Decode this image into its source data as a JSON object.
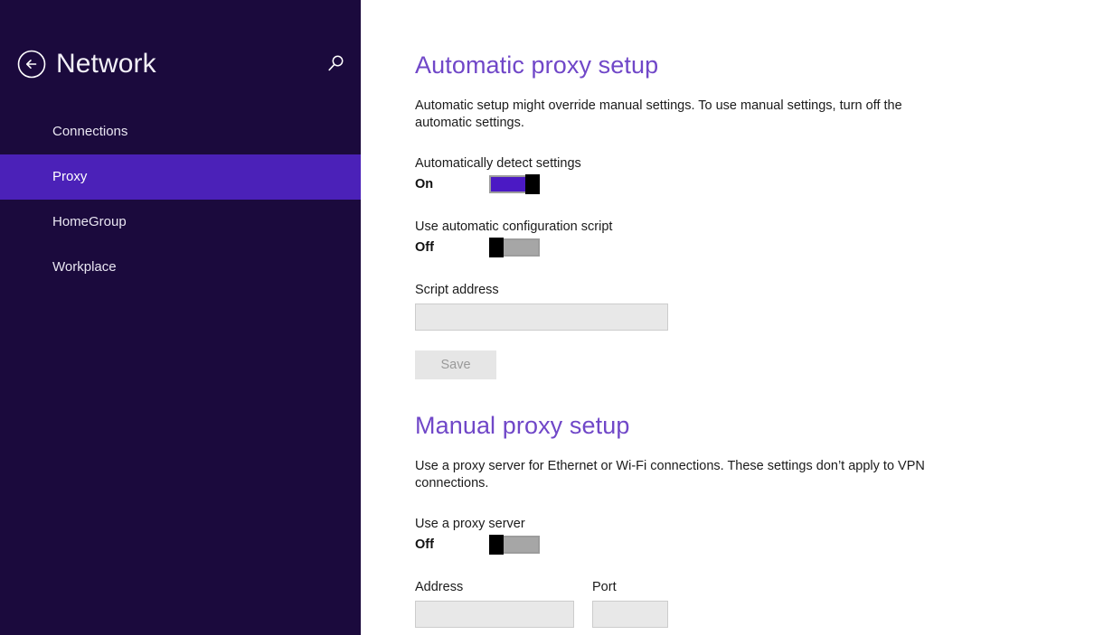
{
  "sidebar": {
    "title": "Network",
    "back_icon": "back-arrow-circle-icon",
    "search_icon": "search-icon",
    "items": [
      {
        "label": "Connections",
        "selected": false
      },
      {
        "label": "Proxy",
        "selected": true
      },
      {
        "label": "HomeGroup",
        "selected": false
      },
      {
        "label": "Workplace",
        "selected": false
      }
    ],
    "colors": {
      "background": "#1b0a3d",
      "selected": "#4b21b8",
      "text": "#e9e6f2"
    }
  },
  "content": {
    "automatic": {
      "title": "Automatic proxy setup",
      "description": "Automatic setup might override manual settings. To use manual settings, turn off the automatic settings.",
      "detect": {
        "label": "Automatically detect settings",
        "state": "On"
      },
      "script_toggle": {
        "label": "Use automatic configuration script",
        "state": "Off"
      },
      "script_address": {
        "label": "Script address",
        "value": "",
        "placeholder": ""
      },
      "save_label": "Save"
    },
    "manual": {
      "title": "Manual proxy setup",
      "description": "Use a proxy server for Ethernet or Wi-Fi connections. These settings don’t apply to VPN connections.",
      "use_proxy": {
        "label": "Use a proxy server",
        "state": "Off"
      },
      "address": {
        "label": "Address",
        "value": "",
        "placeholder": ""
      },
      "port": {
        "label": "Port",
        "value": "",
        "placeholder": ""
      }
    },
    "colors": {
      "heading": "#7047c8",
      "toggle_on": "#4b19c4",
      "toggle_off": "#a6a6a6",
      "input_bg": "#e8e8e8"
    }
  }
}
